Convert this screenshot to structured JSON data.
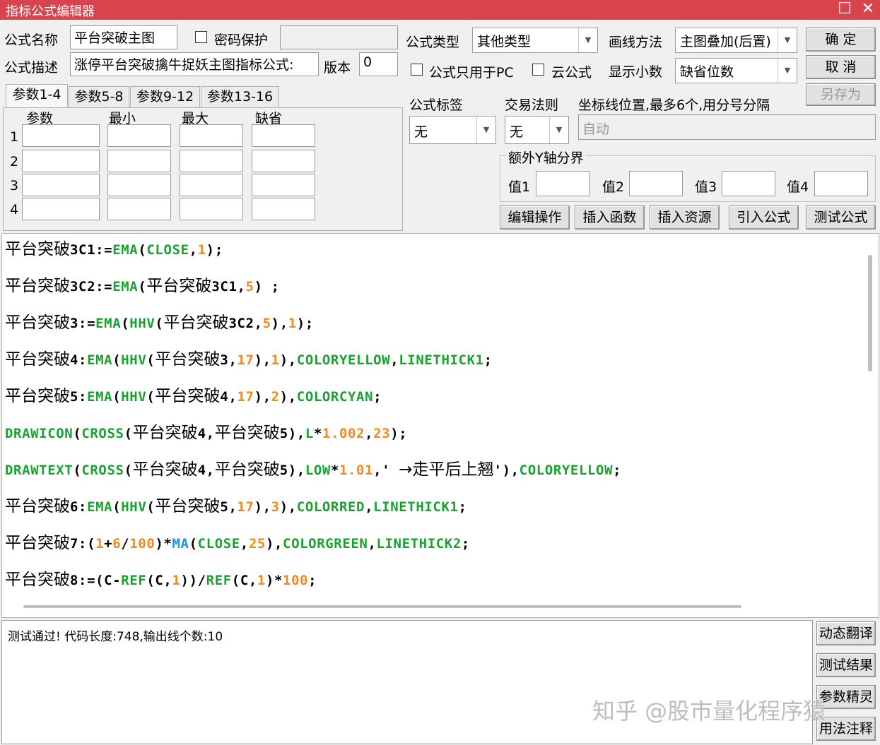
{
  "window": {
    "title": "指标公式编辑器",
    "maximize_glyph": "☐",
    "close_glyph": "✕"
  },
  "form": {
    "name_label": "公式名称",
    "name_value": "平台突破主图",
    "password_label": "密码保护",
    "desc_label": "公式描述",
    "desc_value": "涨停平台突破擒牛捉妖主图指标公式:",
    "version_label": "版本",
    "version_value": "0",
    "type_label": "公式类型",
    "type_value": "其他类型",
    "draw_label": "画线方法",
    "draw_value": "主图叠加(后置)",
    "pc_only_label": "公式只用于PC",
    "cloud_label": "云公式",
    "decimals_label": "显示小数",
    "decimals_value": "缺省位数",
    "tag_label": "公式标签",
    "tag_value": "无",
    "rule_label": "交易法则",
    "rule_value": "无",
    "axis_label": "坐标线位置,最多6个,用分号分隔",
    "axis_value": "自动",
    "extra_y_label": "额外Y轴分界",
    "val_labels": [
      "值1",
      "值2",
      "值3",
      "值4"
    ]
  },
  "buttons": {
    "ok": "确  定",
    "cancel": "取  消",
    "saveas": "另存为",
    "edit_ops": "编辑操作",
    "insert_func": "插入函数",
    "insert_res": "插入资源",
    "import_formula": "引入公式",
    "test_formula": "测试公式",
    "dyn_translate": "动态翻译",
    "test_result": "测试结果",
    "param_wizard": "参数精灵",
    "usage_notes": "用法注释"
  },
  "tabs": [
    "参数1-4",
    "参数5-8",
    "参数9-12",
    "参数13-16"
  ],
  "param_table": {
    "headers": [
      "参数",
      "最小",
      "最大",
      "缺省"
    ],
    "rows": [
      "1",
      "2",
      "3",
      "4"
    ]
  },
  "code_lines": [
    [
      [
        "平台突破",
        "cn"
      ],
      [
        "3C1:=",
        "k"
      ],
      [
        "EMA",
        "g"
      ],
      [
        "(",
        "k"
      ],
      [
        "CLOSE",
        "g"
      ],
      [
        ",",
        "k"
      ],
      [
        "1",
        "o"
      ],
      [
        ");",
        "k"
      ]
    ],
    [
      [
        "平台突破",
        "cn"
      ],
      [
        "3C2:=",
        "k"
      ],
      [
        "EMA",
        "g"
      ],
      [
        "(",
        "k"
      ],
      [
        "平台突破",
        "cn"
      ],
      [
        "3C1,",
        "k"
      ],
      [
        "5",
        "o"
      ],
      [
        ") ;",
        "k"
      ]
    ],
    [
      [
        "平台突破",
        "cn"
      ],
      [
        "3:=",
        "k"
      ],
      [
        "EMA",
        "g"
      ],
      [
        "(",
        "k"
      ],
      [
        "HHV",
        "g"
      ],
      [
        "(",
        "k"
      ],
      [
        "平台突破",
        "cn"
      ],
      [
        "3C2,",
        "k"
      ],
      [
        "5",
        "o"
      ],
      [
        "),",
        "k"
      ],
      [
        "1",
        "o"
      ],
      [
        ");",
        "k"
      ]
    ],
    [
      [
        "平台突破",
        "cn"
      ],
      [
        "4:",
        "k"
      ],
      [
        "EMA",
        "g"
      ],
      [
        "(",
        "k"
      ],
      [
        "HHV",
        "g"
      ],
      [
        "(",
        "k"
      ],
      [
        "平台突破",
        "cn"
      ],
      [
        "3,",
        "k"
      ],
      [
        "17",
        "o"
      ],
      [
        "),",
        "k"
      ],
      [
        "1",
        "o"
      ],
      [
        "),",
        "k"
      ],
      [
        "COLORYELLOW",
        "g"
      ],
      [
        ",",
        "k"
      ],
      [
        "LINETHICK1",
        "g"
      ],
      [
        ";",
        "k"
      ]
    ],
    [
      [
        "平台突破",
        "cn"
      ],
      [
        "5:",
        "k"
      ],
      [
        "EMA",
        "g"
      ],
      [
        "(",
        "k"
      ],
      [
        "HHV",
        "g"
      ],
      [
        "(",
        "k"
      ],
      [
        "平台突破",
        "cn"
      ],
      [
        "4,",
        "k"
      ],
      [
        "17",
        "o"
      ],
      [
        "),",
        "k"
      ],
      [
        "2",
        "o"
      ],
      [
        "),",
        "k"
      ],
      [
        "COLORCYAN",
        "g"
      ],
      [
        ";",
        "k"
      ]
    ],
    [
      [
        "DRAWICON",
        "g"
      ],
      [
        "(",
        "k"
      ],
      [
        "CROSS",
        "g"
      ],
      [
        "(",
        "k"
      ],
      [
        "平台突破",
        "cn"
      ],
      [
        "4,",
        "k"
      ],
      [
        "平台突破",
        "cn"
      ],
      [
        "5),",
        "k"
      ],
      [
        "L",
        "g"
      ],
      [
        "*",
        "k"
      ],
      [
        "1.002",
        "o"
      ],
      [
        ",",
        "k"
      ],
      [
        "23",
        "o"
      ],
      [
        ");",
        "k"
      ]
    ],
    [
      [
        "DRAWTEXT",
        "g"
      ],
      [
        "(",
        "k"
      ],
      [
        "CROSS",
        "g"
      ],
      [
        "(",
        "k"
      ],
      [
        "平台突破",
        "cn"
      ],
      [
        "4,",
        "k"
      ],
      [
        "平台突破",
        "cn"
      ],
      [
        "5),",
        "k"
      ],
      [
        "LOW",
        "g"
      ],
      [
        "*",
        "k"
      ],
      [
        "1.01",
        "o"
      ],
      [
        ",' ",
        "k"
      ],
      [
        "→走平后上翘",
        "cn"
      ],
      [
        "'),",
        "k"
      ],
      [
        "COLORYELLOW",
        "g"
      ],
      [
        ";",
        "k"
      ]
    ],
    [
      [
        "平台突破",
        "cn"
      ],
      [
        "6:",
        "k"
      ],
      [
        "EMA",
        "g"
      ],
      [
        "(",
        "k"
      ],
      [
        "HHV",
        "g"
      ],
      [
        "(",
        "k"
      ],
      [
        "平台突破",
        "cn"
      ],
      [
        "5,",
        "k"
      ],
      [
        "17",
        "o"
      ],
      [
        "),",
        "k"
      ],
      [
        "3",
        "o"
      ],
      [
        "),",
        "k"
      ],
      [
        "COLORRED",
        "g"
      ],
      [
        ",",
        "k"
      ],
      [
        "LINETHICK1",
        "g"
      ],
      [
        ";",
        "k"
      ]
    ],
    [
      [
        "平台突破",
        "cn"
      ],
      [
        "7:(",
        "k"
      ],
      [
        "1",
        "o"
      ],
      [
        "+",
        "k"
      ],
      [
        "6",
        "o"
      ],
      [
        "/",
        "k"
      ],
      [
        "100",
        "o"
      ],
      [
        ")*",
        "k"
      ],
      [
        "MA",
        "b"
      ],
      [
        "(",
        "k"
      ],
      [
        "CLOSE",
        "g"
      ],
      [
        ",",
        "k"
      ],
      [
        "25",
        "o"
      ],
      [
        "),",
        "k"
      ],
      [
        "COLORGREEN",
        "g"
      ],
      [
        ",",
        "k"
      ],
      [
        "LINETHICK2",
        "g"
      ],
      [
        ";",
        "k"
      ]
    ],
    [
      [
        "平台突破",
        "cn"
      ],
      [
        "8:=(C-",
        "k"
      ],
      [
        "REF",
        "g"
      ],
      [
        "(C,",
        "k"
      ],
      [
        "1",
        "o"
      ],
      [
        "))/",
        "k"
      ],
      [
        "REF",
        "g"
      ],
      [
        "(C,",
        "k"
      ],
      [
        "1",
        "o"
      ],
      [
        ")*",
        "k"
      ],
      [
        "100",
        "o"
      ],
      [
        ";",
        "k"
      ]
    ]
  ],
  "output_text": "测试通过! 代码长度:748,输出线个数:10",
  "watermark": "知乎 @股市量化程序猿"
}
